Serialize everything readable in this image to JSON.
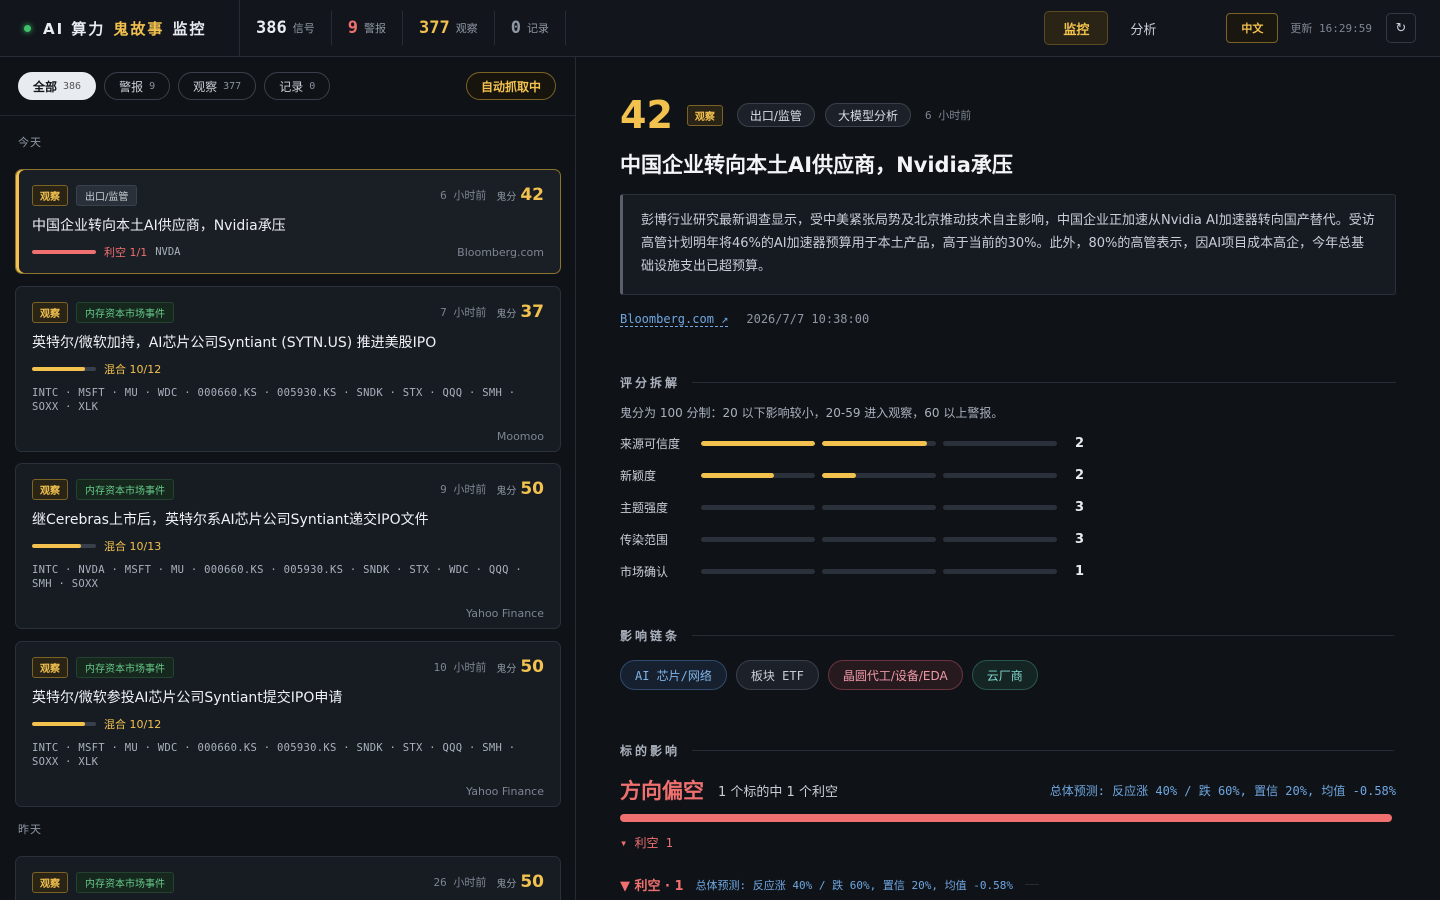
{
  "header": {
    "title_a": "AI 算力",
    "title_b": "鬼故事",
    "title_c": "监控",
    "stats": [
      {
        "num": "386",
        "label": "信号",
        "color": "#e8ebef"
      },
      {
        "num": "9",
        "label": "警报",
        "color": "#f0706f"
      },
      {
        "num": "377",
        "label": "观察",
        "color": "#f2c14e"
      },
      {
        "num": "0",
        "label": "记录",
        "color": "#8f97a3"
      }
    ],
    "nav_monitor": "监控",
    "nav_analysis": "分析",
    "lang": "中文",
    "updated_label": "更新",
    "updated_time": "16:29:59",
    "refresh_icon": "↻"
  },
  "filters": {
    "all": {
      "label": "全部",
      "count": "386"
    },
    "alert": {
      "label": "警报",
      "count": "9"
    },
    "watch": {
      "label": "观察",
      "count": "377"
    },
    "record": {
      "label": "记录",
      "count": "0"
    },
    "auto": "自动抓取中"
  },
  "days": {
    "today": "今天",
    "yesterday": "昨天"
  },
  "cards": [
    {
      "level": "观察",
      "category": "出口/监管",
      "time": "6 小时前",
      "ghost_label": "鬼分",
      "score": "42",
      "title": "中国企业转向本土AI供应商，Nvidia承压",
      "bar_pct": 1.0,
      "bar_color": "#f0706f",
      "sentiment": "利空 1/1",
      "sentiment_color": "#f0706f",
      "tickers_inline": "NVDA",
      "tickers": "",
      "source": "Bloomberg.com"
    },
    {
      "level": "观察",
      "category": "内存资本市场事件",
      "time": "7 小时前",
      "ghost_label": "鬼分",
      "score": "37",
      "title": "英特尔/微软加持，AI芯片公司Syntiant (SYTN.US) 推进美股IPO",
      "bar_pct": 0.83,
      "bar_color": "#f2c14e",
      "sentiment": "混合 10/12",
      "sentiment_color": "#f2c14e",
      "tickers_inline": "",
      "tickers": "INTC · MSFT · MU · WDC · 000660.KS · 005930.KS · SNDK · STX · QQQ · SMH · SOXX · XLK",
      "source": "Moomoo"
    },
    {
      "level": "观察",
      "category": "内存资本市场事件",
      "time": "9 小时前",
      "ghost_label": "鬼分",
      "score": "50",
      "title": "继Cerebras上市后，英特尔系AI芯片公司Syntiant递交IPO文件",
      "bar_pct": 0.77,
      "bar_color": "#f2c14e",
      "sentiment": "混合 10/13",
      "sentiment_color": "#f2c14e",
      "tickers_inline": "",
      "tickers": "INTC · NVDA · MSFT · MU · 000660.KS · 005930.KS · SNDK · STX · WDC · QQQ · SMH · SOXX",
      "source": "Yahoo Finance"
    },
    {
      "level": "观察",
      "category": "内存资本市场事件",
      "time": "10 小时前",
      "ghost_label": "鬼分",
      "score": "50",
      "title": "英特尔/微软参投AI芯片公司Syntiant提交IPO申请",
      "bar_pct": 0.83,
      "bar_color": "#f2c14e",
      "sentiment": "混合 10/12",
      "sentiment_color": "#f2c14e",
      "tickers_inline": "",
      "tickers": "INTC · MSFT · MU · WDC · 000660.KS · 005930.KS · SNDK · STX · QQQ · SMH · SOXX · XLK",
      "source": "Yahoo Finance"
    },
    {
      "level": "观察",
      "category": "内存资本市场事件",
      "time": "26 小时前",
      "ghost_label": "鬼分",
      "score": "50",
      "title": "",
      "bar_pct": 0,
      "bar_color": "#f2c14e",
      "sentiment": "",
      "sentiment_color": "#f2c14e",
      "tickers_inline": "",
      "tickers": "",
      "source": ""
    }
  ],
  "detail": {
    "score": "42",
    "level": "观察",
    "cat1": "出口/监管",
    "cat2": "大模型分析",
    "time": "6 小时前",
    "title": "中国企业转向本土AI供应商，Nvidia承压",
    "summary": "彭博行业研究最新调查显示，受中美紧张局势及北京推动技术自主影响，中国企业正加速从Nvidia AI加速器转向国产替代。受访高管计划明年将46%的AI加速器预算用于本土产品，高于当前的30%。此外，80%的高管表示，因AI项目成本高企，今年总基础设施支出已超预算。",
    "source": "Bloomberg.com ↗",
    "date": "2026/7/7 10:38:00",
    "score_section": "评分拆解",
    "score_note": "鬼分为 100 分制：20 以下影响较小，20-59 进入观察，60 以上警报。",
    "score_rows": [
      {
        "label": "来源可信度",
        "value": "2",
        "segs": [
          1.0,
          0.92,
          0
        ]
      },
      {
        "label": "新颖度",
        "value": "2",
        "segs": [
          0.64,
          0.3,
          0
        ]
      },
      {
        "label": "主题强度",
        "value": "3",
        "segs": [
          0,
          0,
          0
        ]
      },
      {
        "label": "传染范围",
        "value": "3",
        "segs": [
          0,
          0,
          0
        ]
      },
      {
        "label": "市场确认",
        "value": "1",
        "segs": [
          0,
          0,
          0
        ]
      }
    ],
    "chain_section": "影响链条",
    "chain": [
      {
        "label": "AI 芯片/网络",
        "style": "blue"
      },
      {
        "label": "板块 ETF",
        "style": "gray"
      },
      {
        "label": "晶圆代工/设备/EDA",
        "style": "red"
      },
      {
        "label": "云厂商",
        "style": "teal"
      }
    ],
    "impact_section": "标的影响",
    "direction": "方向偏空",
    "direction_count": "1 个标的中 1 个利空",
    "prediction": "总体预测: 反应涨 40% / 跌 60%, 置信 20%, 均值 -0.58%",
    "bear_bar_pct": 1.0,
    "bear_line": "▾ 利空 1",
    "bear_group": "▼ 利空 · 1",
    "bear_pred": "总体预测: 反应涨 40% / 跌 60%, 置信 20%, 均值 -0.58%"
  },
  "colors": {
    "accent": "#f2c14e",
    "bear": "#f0706f",
    "link": "#6fa6e0",
    "live": "#3fc26a"
  }
}
